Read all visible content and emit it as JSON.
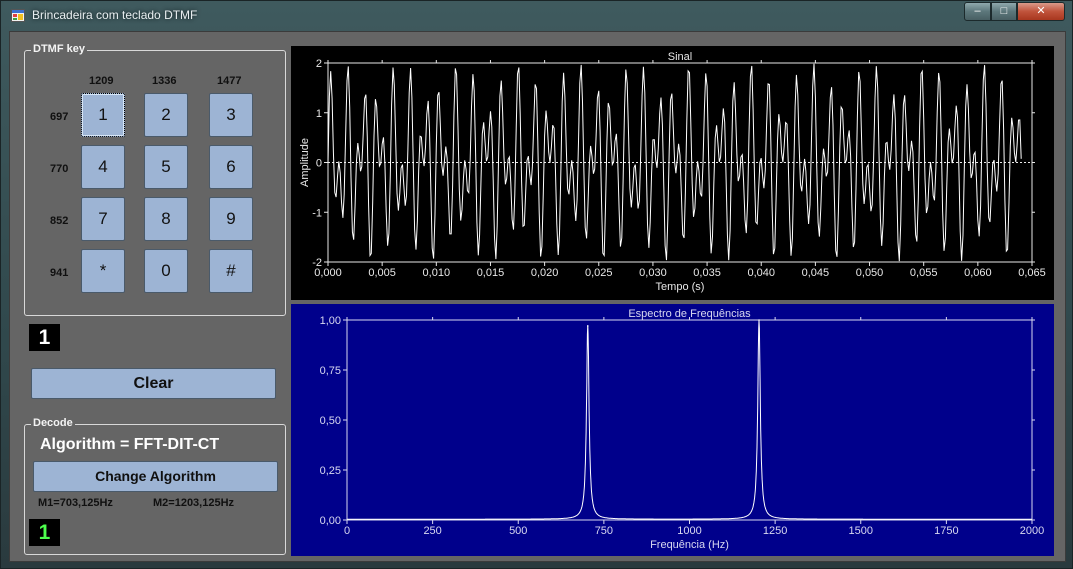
{
  "window": {
    "title": "Brincadeira com teclado DTMF",
    "controls": {
      "minimize": "–",
      "maximize": "□",
      "close": "✕"
    }
  },
  "dtmf_group": {
    "title": "DTMF key",
    "column_freqs": [
      "1209",
      "1336",
      "1477"
    ],
    "row_freqs": [
      "697",
      "770",
      "852",
      "941"
    ],
    "keys": [
      [
        "1",
        "2",
        "3"
      ],
      [
        "4",
        "5",
        "6"
      ],
      [
        "7",
        "8",
        "9"
      ],
      [
        "*",
        "0",
        "#"
      ]
    ],
    "focused_key": "1"
  },
  "key_display": "1",
  "clear_button": "Clear",
  "decode_group": {
    "title": "Decode",
    "algorithm_label": "Algorithm = FFT-DIT-CT",
    "change_button": "Change Algorithm",
    "m1": "M1=703,125Hz",
    "m2": "M2=1203,125Hz",
    "detected": "1"
  },
  "icons": {
    "app_icon": "window-app-icon"
  },
  "colors": {
    "button_fill": "#9db4d4",
    "panel_bg": "#656565",
    "signal_bg": "#000000",
    "spectrum_bg": "#00008b",
    "trace": "#ffffff",
    "detected_text": "#4dff4d"
  },
  "chart_data": [
    {
      "type": "line",
      "title": "Sinal",
      "xlabel": "Tempo (s)",
      "ylabel": "Amplitude",
      "xlim": [
        0,
        0.065
      ],
      "ylim": [
        -2,
        2
      ],
      "x_ticks": [
        "0,000",
        "0,005",
        "0,010",
        "0,015",
        "0,020",
        "0,025",
        "0,030",
        "0,035",
        "0,040",
        "0,045",
        "0,050",
        "0,055",
        "0,060",
        "0,065"
      ],
      "y_ticks": [
        "2",
        "1",
        "0",
        "-1",
        "-2"
      ],
      "grid": false,
      "zero_line": true,
      "series": [
        {
          "components_hz": [
            697,
            1209
          ],
          "amplitudes": [
            1,
            1
          ],
          "x_range": [
            0,
            0.064
          ]
        }
      ]
    },
    {
      "type": "line",
      "title": "Espectro de Frequências",
      "xlabel": "Frequência (Hz)",
      "ylabel": "",
      "xlim": [
        0,
        2000
      ],
      "ylim": [
        0,
        1
      ],
      "x_ticks": [
        "0",
        "250",
        "500",
        "750",
        "1000",
        "1250",
        "1500",
        "1750",
        "2000"
      ],
      "y_ticks": [
        "1,00",
        "0,75",
        "0,50",
        "0,25",
        "0,00"
      ],
      "grid": false,
      "series": [
        {
          "peaks": [
            {
              "x": 703,
              "y": 0.97
            },
            {
              "x": 1203,
              "y": 1.0
            }
          ]
        }
      ]
    }
  ]
}
